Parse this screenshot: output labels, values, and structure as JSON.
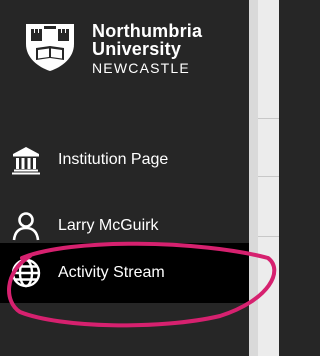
{
  "logo": {
    "line1": "Northumbria",
    "line2": "University",
    "line3": "NEWCASTLE",
    "crest_icon": "university-crest-icon"
  },
  "nav": {
    "items": [
      {
        "label": "Institution Page",
        "icon": "institution-icon"
      },
      {
        "label": "Larry McGuirk",
        "icon": "user-icon"
      },
      {
        "label": "Activity Stream",
        "icon": "globe-icon",
        "active": true
      }
    ]
  },
  "colors": {
    "sidebar_bg": "#262626",
    "active_bg": "#000000",
    "text": "#ffffff",
    "annotation": "#d6216f"
  }
}
